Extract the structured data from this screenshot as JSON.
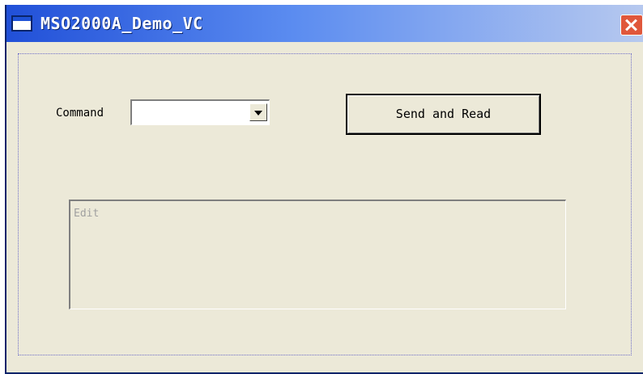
{
  "window": {
    "title": "MSO2000A_Demo_VC",
    "icon": "app-window-icon",
    "close_icon": "close-icon",
    "titlebar_color": "#2150d8",
    "close_color": "#e0573b",
    "background_color": "#ece9d8"
  },
  "form": {
    "command_label": "Command",
    "command_value": "",
    "dropdown_icon": "chevron-down-icon",
    "send_button_label": "Send and Read",
    "edit_text": "Edit"
  }
}
